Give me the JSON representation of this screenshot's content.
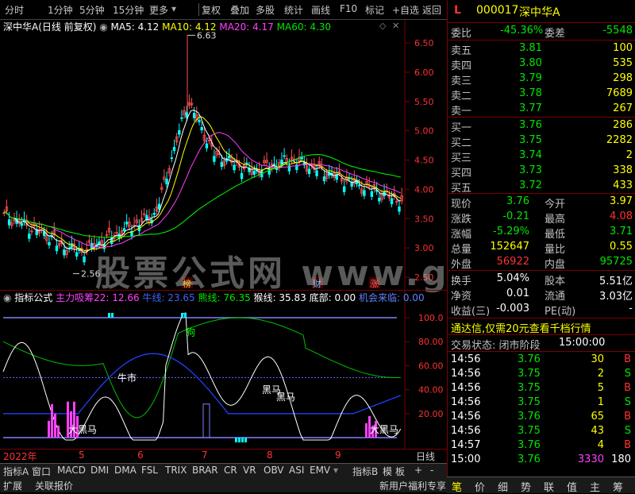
{
  "toolbar": {
    "left_items": [
      "分时",
      "1分钟",
      "5分钟",
      "15分钟",
      "更多"
    ],
    "right_items": [
      "复权",
      "叠加",
      "多股",
      "统计",
      "画线",
      "F10",
      "标记",
      "+自选",
      "返回"
    ]
  },
  "main_chart": {
    "stock_title": "深中华A(日线 前复权)",
    "ma5": "MA5: 4.12",
    "ma10": "MA10: 4.12",
    "ma20": "MA20: 4.17",
    "ma60": "MA60: 4.30",
    "high_label": "6.63",
    "low_label": "2.56",
    "y_ticks": [
      "6.50",
      "6.00",
      "5.50",
      "5.00",
      "4.50",
      "4.00",
      "3.50",
      "3.00",
      "2.50"
    ],
    "markers": [
      "榜",
      "财",
      "涨"
    ],
    "colors": {
      "ma5": "#ffffff",
      "ma10": "#ffff00",
      "ma20": "#ff40ff",
      "ma60": "#00ff00",
      "up": "#ff5050",
      "down": "#00ffff"
    }
  },
  "indicator": {
    "name": "指标公式",
    "zlxc": "主力吸筹22: 12.66",
    "niu": "牛线: 23.65",
    "xiong": "熊线: 76.35",
    "hou": "猴线: 35.83",
    "di": "底部: 0.00",
    "jihui": "机会来临: 0.00",
    "y_ticks": [
      "100.0",
      "80.00",
      "60.00",
      "40.00",
      "20.00"
    ],
    "labels": [
      "牛市",
      "黑马",
      "黑马",
      "大黑马",
      "大黑马",
      "狗"
    ]
  },
  "x_axis": {
    "labels": [
      "2022年",
      "5",
      "6",
      "7",
      "8",
      "9"
    ],
    "period": "日线"
  },
  "bottom_tabs": [
    "指标A",
    "窗口",
    "MACD",
    "DMI",
    "DMA",
    "FSL",
    "TRIX",
    "BRAR",
    "CR",
    "VR",
    "OBV",
    "ASI",
    "EMV"
  ],
  "bottom_right_tabs": [
    "指标B",
    "模",
    "板"
  ],
  "status_bar": {
    "expand": "扩展",
    "related": "关联报价",
    "promo": "新用户福利专享"
  },
  "quote": {
    "code": "000017",
    "name": "深中华A",
    "weibi_label": "委比",
    "weibi": "-45.36%",
    "weicha_label": "委差",
    "weicha": "-5548",
    "sells": [
      {
        "label": "卖五",
        "price": "3.81",
        "vol": "100"
      },
      {
        "label": "卖四",
        "price": "3.80",
        "vol": "535"
      },
      {
        "label": "卖三",
        "price": "3.79",
        "vol": "298"
      },
      {
        "label": "卖二",
        "price": "3.78",
        "vol": "7689"
      },
      {
        "label": "卖一",
        "price": "3.77",
        "vol": "267"
      }
    ],
    "buys": [
      {
        "label": "买一",
        "price": "3.76",
        "vol": "286"
      },
      {
        "label": "买二",
        "price": "3.75",
        "vol": "2282"
      },
      {
        "label": "买三",
        "price": "3.74",
        "vol": "2"
      },
      {
        "label": "买四",
        "price": "3.73",
        "vol": "338"
      },
      {
        "label": "买五",
        "price": "3.72",
        "vol": "433"
      }
    ],
    "stats": [
      {
        "l1": "现价",
        "v1": "3.76",
        "l2": "今开",
        "v2": "3.97"
      },
      {
        "l1": "涨跌",
        "v1": "-0.21",
        "l2": "最高",
        "v2": "4.08"
      },
      {
        "l1": "涨幅",
        "v1": "-5.29%",
        "l2": "最低",
        "v2": "3.71"
      },
      {
        "l1": "总量",
        "v1": "152647",
        "l2": "量比",
        "v2": "0.55"
      },
      {
        "l1": "外盘",
        "v1": "56922",
        "l2": "内盘",
        "v2": "95725"
      }
    ],
    "stats2": [
      {
        "l1": "换手",
        "v1": "5.04%",
        "l2": "股本",
        "v2": "5.51亿"
      },
      {
        "l1": "净资",
        "v1": "0.01",
        "l2": "流通",
        "v2": "3.03亿"
      },
      {
        "l1": "收益(三)",
        "v1": "-0.003",
        "l2": "PE(动)",
        "v2": "-"
      }
    ],
    "ad": "通达信,仅需20元查看千档行情",
    "trade_status_label": "交易状态: 闭市阶段",
    "trade_status_time": "15:00:00",
    "ticks": [
      {
        "t": "14:56",
        "p": "3.76",
        "v": "30",
        "s": "B"
      },
      {
        "t": "14:56",
        "p": "3.75",
        "v": "2",
        "s": "S"
      },
      {
        "t": "14:56",
        "p": "3.75",
        "v": "5",
        "s": "B"
      },
      {
        "t": "14:56",
        "p": "3.75",
        "v": "1",
        "s": "S"
      },
      {
        "t": "14:56",
        "p": "3.76",
        "v": "65",
        "s": "B"
      },
      {
        "t": "14:56",
        "p": "3.75",
        "v": "43",
        "s": "S"
      },
      {
        "t": "14:57",
        "p": "3.76",
        "v": "4",
        "s": "B"
      },
      {
        "t": "15:00",
        "p": "3.76",
        "v": "3330",
        "s": "180"
      }
    ],
    "bottom_tabs": [
      "笔",
      "价",
      "细",
      "势",
      "联",
      "值",
      "主",
      "筹"
    ]
  },
  "watermark": "股票公式网 www.gpxs.com"
}
